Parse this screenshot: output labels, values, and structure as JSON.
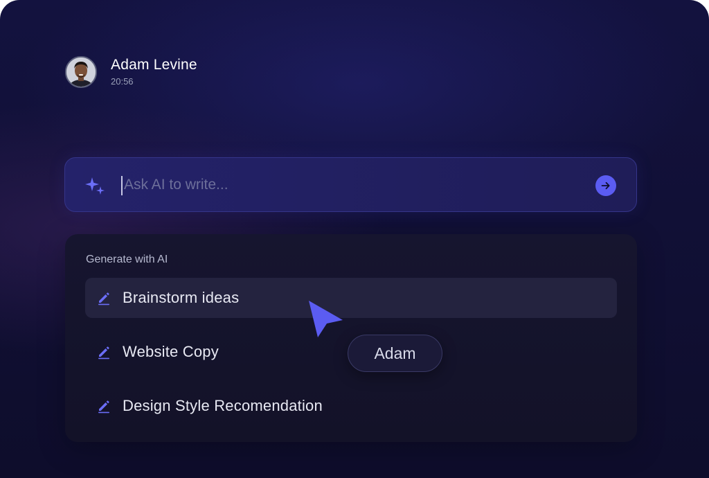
{
  "user": {
    "name": "Adam Levine",
    "time": "20:56"
  },
  "prompt": {
    "placeholder": "Ask AI to write...",
    "value": "",
    "icon": "sparkle-icon",
    "send_icon": "arrow-right-icon"
  },
  "generate": {
    "title": "Generate with AI",
    "options": [
      {
        "label": "Brainstorm ideas",
        "icon": "pencil-icon",
        "active": true
      },
      {
        "label": "Website Copy",
        "icon": "pencil-icon",
        "active": false
      },
      {
        "label": "Design Style Recomendation",
        "icon": "pencil-icon",
        "active": false
      }
    ]
  },
  "collaborator": {
    "name": "Adam"
  },
  "colors": {
    "accent": "#5b5cf2",
    "background": "#121139",
    "panel": "#15142d"
  }
}
